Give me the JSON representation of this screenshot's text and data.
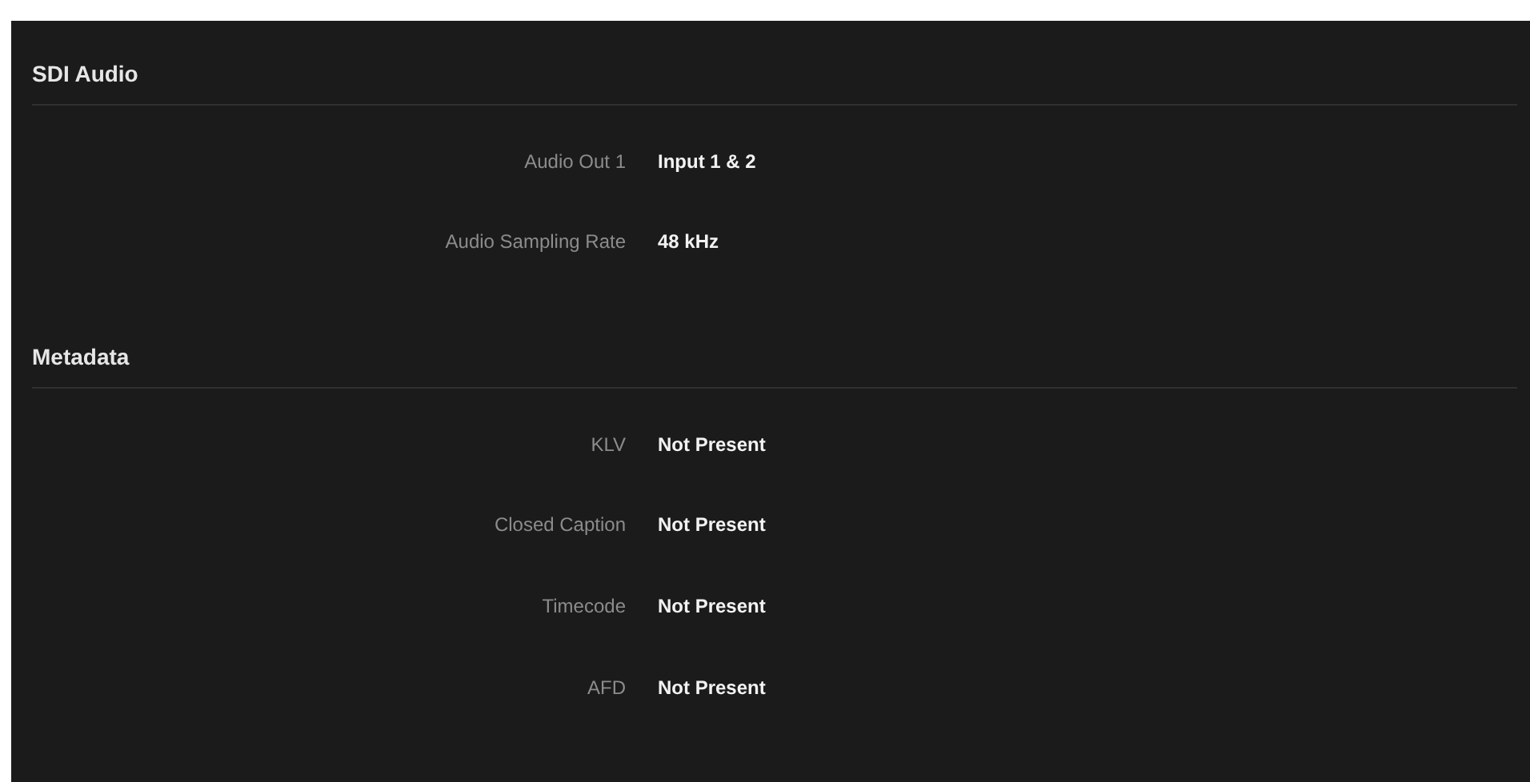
{
  "sections": [
    {
      "title": "SDI Audio",
      "rows": [
        {
          "label": "Audio Out 1",
          "value": "Input 1 & 2"
        },
        {
          "label": "Audio Sampling Rate",
          "value": "48 kHz"
        }
      ]
    },
    {
      "title": "Metadata",
      "rows": [
        {
          "label": "KLV",
          "value": "Not Present"
        },
        {
          "label": "Closed Caption",
          "value": "Not Present"
        },
        {
          "label": "Timecode",
          "value": "Not Present"
        },
        {
          "label": "AFD",
          "value": "Not Present"
        }
      ]
    }
  ]
}
